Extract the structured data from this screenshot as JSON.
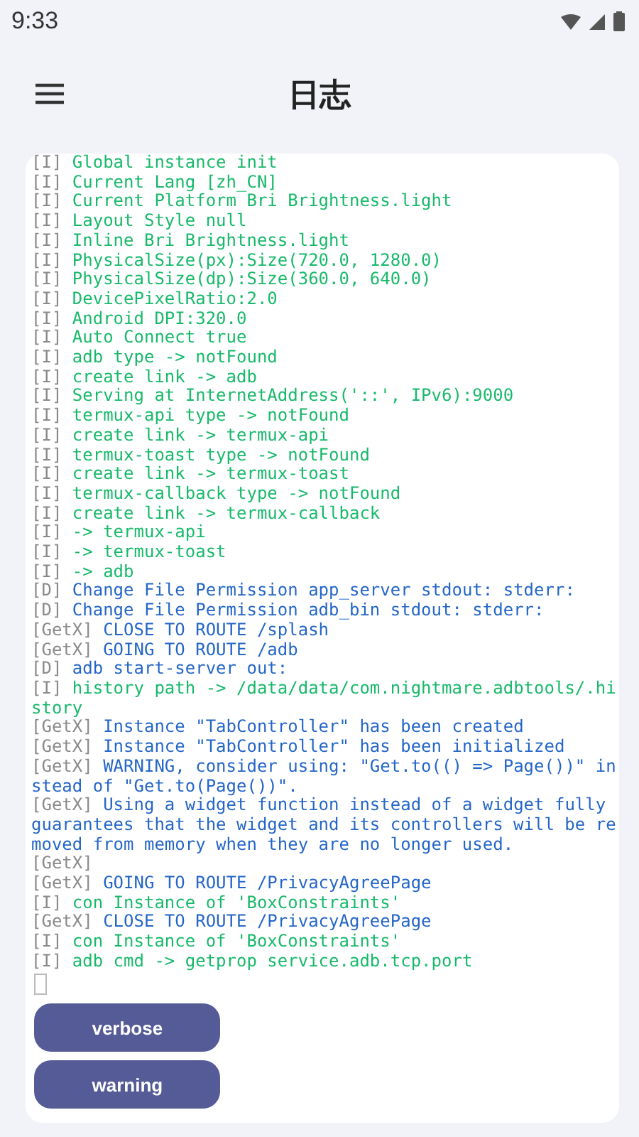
{
  "status_bar": {
    "time": "9:33"
  },
  "app_bar": {
    "title": "日志"
  },
  "log": [
    {
      "tag": "[I]",
      "kind": "info",
      "text": "Global instance init"
    },
    {
      "tag": "[I]",
      "kind": "info",
      "text": "Current Lang [zh_CN]"
    },
    {
      "tag": "[I]",
      "kind": "info",
      "text": "Current Platform Bri Brightness.light"
    },
    {
      "tag": "[I]",
      "kind": "info",
      "text": "Layout Style null"
    },
    {
      "tag": "[I]",
      "kind": "info",
      "text": "Inline Bri Brightness.light"
    },
    {
      "tag": "[I]",
      "kind": "info",
      "text": "PhysicalSize(px):Size(720.0, 1280.0)"
    },
    {
      "tag": "[I]",
      "kind": "info",
      "text": "PhysicalSize(dp):Size(360.0, 640.0)"
    },
    {
      "tag": "[I]",
      "kind": "info",
      "text": "DevicePixelRatio:2.0"
    },
    {
      "tag": "[I]",
      "kind": "info",
      "text": "Android DPI:320.0"
    },
    {
      "tag": "[I]",
      "kind": "info",
      "text": "Auto Connect true"
    },
    {
      "tag": "[I]",
      "kind": "info",
      "text": "adb type -> notFound"
    },
    {
      "tag": "[I]",
      "kind": "info",
      "text": "create link -> adb"
    },
    {
      "tag": "[I]",
      "kind": "info",
      "text": "Serving at InternetAddress('::', IPv6):9000"
    },
    {
      "tag": "[I]",
      "kind": "info",
      "text": "termux-api type -> notFound"
    },
    {
      "tag": "[I]",
      "kind": "info",
      "text": "create link -> termux-api"
    },
    {
      "tag": "[I]",
      "kind": "info",
      "text": "termux-toast type -> notFound"
    },
    {
      "tag": "[I]",
      "kind": "info",
      "text": "create link -> termux-toast"
    },
    {
      "tag": "[I]",
      "kind": "info",
      "text": "termux-callback type -> notFound"
    },
    {
      "tag": "[I]",
      "kind": "info",
      "text": "create link -> termux-callback"
    },
    {
      "tag": "[I]",
      "kind": "info",
      "text": "-> termux-api"
    },
    {
      "tag": "[I]",
      "kind": "info",
      "text": "-> termux-toast"
    },
    {
      "tag": "[I]",
      "kind": "info",
      "text": "-> adb"
    },
    {
      "tag": "[D]",
      "kind": "debug",
      "text": "Change File Permission app_server stdout: stderr:"
    },
    {
      "tag": "[D]",
      "kind": "debug",
      "text": "Change File Permission adb_bin stdout: stderr:"
    },
    {
      "tag": "[GetX]",
      "kind": "debug",
      "text": "CLOSE TO ROUTE /splash"
    },
    {
      "tag": "[GetX]",
      "kind": "debug",
      "text": "GOING TO ROUTE /adb"
    },
    {
      "tag": "[D]",
      "kind": "debug",
      "text": "adb start-server out:"
    },
    {
      "tag": "[I]",
      "kind": "info",
      "text": "history path -> /data/data/com.nightmare.adbtools/.history"
    },
    {
      "tag": "[GetX]",
      "kind": "debug",
      "text": "Instance \"TabController\" has been created"
    },
    {
      "tag": "[GetX]",
      "kind": "debug",
      "text": "Instance \"TabController\" has been initialized"
    },
    {
      "tag": "[GetX]",
      "kind": "debug",
      "text": "WARNING, consider using: \"Get.to(() => Page())\" instead of \"Get.to(Page())\"."
    },
    {
      "tag": "[GetX]",
      "kind": "debug",
      "text": "Using a widget function instead of a widget fully guarantees that the widget and its controllers will be removed from memory when they are no longer used."
    },
    {
      "tag": "[GetX]",
      "kind": "debug"
    },
    {
      "tag": "[GetX]",
      "kind": "debug",
      "text": "GOING TO ROUTE /PrivacyAgreePage"
    },
    {
      "tag": "[I]",
      "kind": "info",
      "text": "con Instance of 'BoxConstraints'"
    },
    {
      "tag": "[GetX]",
      "kind": "debug",
      "text": "CLOSE TO ROUTE /PrivacyAgreePage"
    },
    {
      "tag": "[I]",
      "kind": "info",
      "text": "con Instance of 'BoxConstraints'"
    },
    {
      "tag": "[I]",
      "kind": "info",
      "text": "adb cmd -> getprop service.adb.tcp.port"
    }
  ],
  "button_rows": [
    [
      {
        "label": "verbose"
      }
    ],
    [
      {
        "label": "warning"
      }
    ]
  ]
}
